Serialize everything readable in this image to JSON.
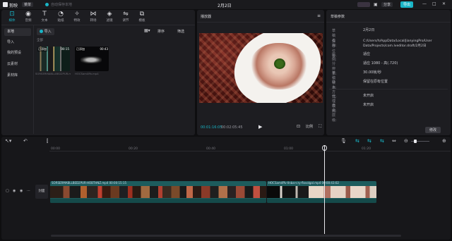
{
  "app": {
    "name": "剪映",
    "menu_label": "菜单",
    "project_status": "自动保存本地",
    "title": "2月2日"
  },
  "titlebar": {
    "feedback": "",
    "share": "分享",
    "export": "导出"
  },
  "toolbar": {
    "items": [
      {
        "label": "媒体",
        "icon": "media-icon"
      },
      {
        "label": "音频",
        "icon": "audio-icon"
      },
      {
        "label": "文本",
        "icon": "text-icon"
      },
      {
        "label": "贴纸",
        "icon": "sticker-icon"
      },
      {
        "label": "特效",
        "icon": "effects-icon"
      },
      {
        "label": "转场",
        "icon": "transition-icon"
      },
      {
        "label": "滤镜",
        "icon": "filter-icon"
      },
      {
        "label": "调节",
        "icon": "adjust-icon"
      },
      {
        "label": "模板",
        "icon": "template-icon"
      }
    ]
  },
  "sidebar": {
    "items": [
      {
        "label": "本地",
        "active": true
      },
      {
        "label": "导入",
        "active": false
      },
      {
        "label": "我的预设",
        "active": false
      },
      {
        "label": "云素材",
        "active": false
      },
      {
        "label": "素材库",
        "active": false
      }
    ]
  },
  "media": {
    "import_label": "导入",
    "view_label": "全部",
    "sort_label": "排序",
    "filter_label": "筛选",
    "section_label": "全部",
    "clips": [
      {
        "badge": "已添加",
        "duration": "00:15",
        "name": "SORSERMABLLBED2PUR.mp4"
      },
      {
        "badge": "已添加",
        "duration": "00:43",
        "name": "HOCSam4ffv.mp4"
      }
    ]
  },
  "player": {
    "title": "播放器",
    "timecode_current": "00:01:16:05",
    "timecode_total": "00:02:05:45",
    "ratio_label": "比例",
    "fullscreen_label": "全屏"
  },
  "draft": {
    "title": "草稿参数",
    "fields": [
      {
        "key": "草稿名称:",
        "value": "2月2日"
      },
      {
        "key": "保存位置:",
        "value": "C:/Users/h/AppData/Local/JianyingPro/User Data/Projects/com.lveditor.draft/2月2日"
      },
      {
        "key": "比例:",
        "value": "适应"
      },
      {
        "key": "分辨率:",
        "value": "适应 1080 - 高(.720)"
      },
      {
        "key": "草稿帧率:",
        "value": "30.00帧/秒"
      },
      {
        "key": "导入方式:",
        "value": "保留在原有位置"
      },
      {
        "key": "代理模式:",
        "value": "未开启"
      },
      {
        "key": "自由层级:",
        "value": "未开启"
      }
    ],
    "edit_label": "修改"
  },
  "timeline": {
    "ruler_labels": [
      "00:00",
      "00:20",
      "00:40",
      "01:00",
      "01:20",
      "01:40",
      "02:00",
      "02:20",
      "02:40"
    ],
    "track_label": "封面",
    "clip1_label": "SORSERMABLLBED2PUR-HOBTHNZ.mp4   00:00:15:15",
    "clip2_label": "HOCSam4ffv-llnbar-cry-flovolgal.mp4   00:00:43:02"
  }
}
